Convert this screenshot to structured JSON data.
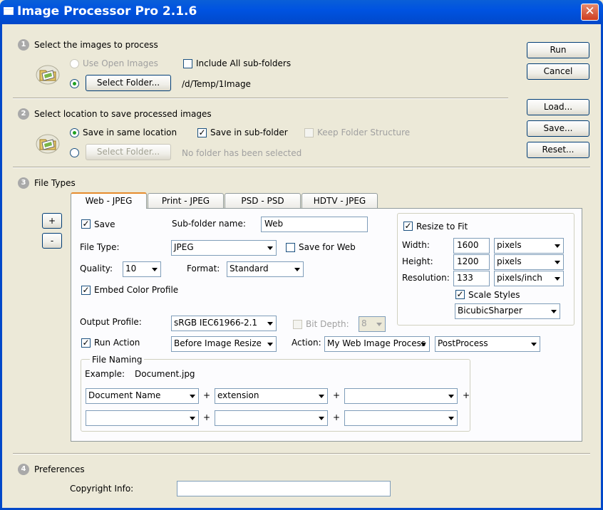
{
  "window": {
    "title": "Image Processor Pro 2.1.6",
    "close_glyph": "✕"
  },
  "buttons": {
    "run": "Run",
    "cancel": "Cancel",
    "load": "Load...",
    "save": "Save...",
    "reset": "Reset..."
  },
  "section1": {
    "number": "1",
    "title": "Select the images to process",
    "use_open_images": "Use Open Images",
    "include_subfolders": "Include All sub-folders",
    "select_folder": "Select Folder...",
    "folder_path": "/d/Temp/1Image"
  },
  "section2": {
    "number": "2",
    "title": "Select location to save processed images",
    "save_same_location": "Save in same location",
    "save_in_subfolder": "Save in sub-folder",
    "keep_folder_structure": "Keep Folder Structure",
    "select_folder": "Select Folder...",
    "no_folder": "No folder has been selected"
  },
  "section3": {
    "number": "3",
    "title": "File Types",
    "plus": "+",
    "minus": "-",
    "tabs": [
      "Web - JPEG",
      "Print - JPEG",
      "PSD - PSD",
      "HDTV - JPEG"
    ],
    "save_label": "Save",
    "subfolder_label": "Sub-folder name:",
    "subfolder_value": "Web",
    "file_type_label": "File Type:",
    "file_type_value": "JPEG",
    "save_for_web": "Save for Web",
    "quality_label": "Quality:",
    "quality_value": "10",
    "format_label": "Format:",
    "format_value": "Standard",
    "embed_color_profile": "Embed Color Profile",
    "output_profile_label": "Output Profile:",
    "output_profile_value": "sRGB IEC61966-2.1",
    "bit_depth_label": "Bit Depth:",
    "bit_depth_value": "8",
    "run_action_label": "Run Action",
    "run_action_when": "Before Image Resize",
    "action_label": "Action:",
    "action_value": "My Web Image Process",
    "action_set_value": "PostProcess",
    "resize": {
      "resize_to_fit": "Resize to Fit",
      "width_label": "Width:",
      "width_value": "1600",
      "width_unit": "pixels",
      "height_label": "Height:",
      "height_value": "1200",
      "height_unit": "pixels",
      "resolution_label": "Resolution:",
      "resolution_value": "133",
      "resolution_unit": "pixels/inch",
      "scale_styles": "Scale Styles",
      "resample": "BicubicSharper"
    },
    "naming": {
      "group_title": "File Naming",
      "example_label": "Example:",
      "example_value": "Document.jpg",
      "row1": [
        "Document Name",
        "extension",
        ""
      ],
      "row2": [
        "",
        "",
        ""
      ],
      "plus": "+"
    }
  },
  "section4": {
    "number": "4",
    "title": "Preferences",
    "copyright_label": "Copyright Info:",
    "copyright_value": ""
  }
}
